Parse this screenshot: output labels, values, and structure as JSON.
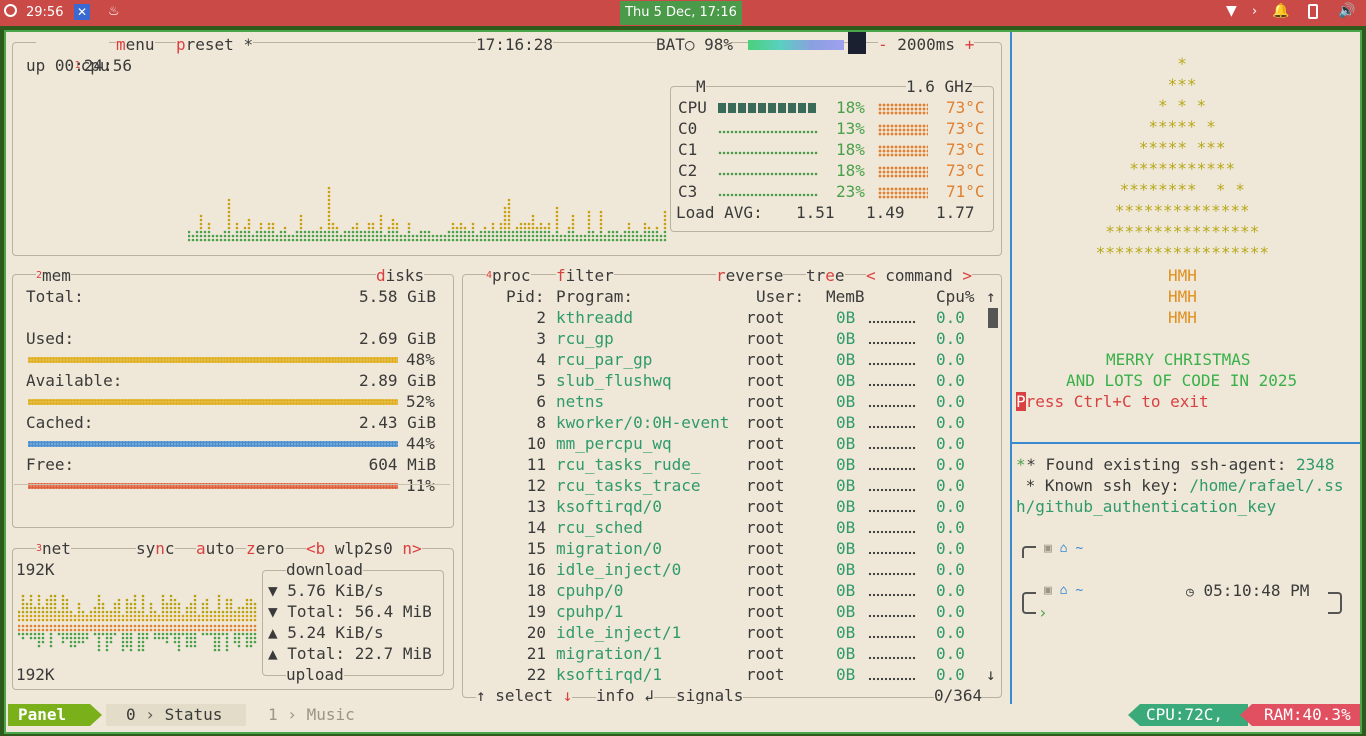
{
  "topbar": {
    "time": "29:56",
    "clock": "Thu  5 Dec, 17:16"
  },
  "cpu_box": {
    "title_num": "1",
    "title": "cpu",
    "menu": "menu",
    "preset": "preset *",
    "time": "17:16:28",
    "bat_label": "BAT○ 98%",
    "interval": "2000ms",
    "uptime": "up 00:24:56",
    "freq_label": "M",
    "freq": "1.6 GHz",
    "cores": [
      {
        "name": "CPU",
        "pct": "18%",
        "temp": "73°C"
      },
      {
        "name": "C0",
        "pct": "13%",
        "temp": "73°C"
      },
      {
        "name": "C1",
        "pct": "18%",
        "temp": "73°C"
      },
      {
        "name": "C2",
        "pct": "18%",
        "temp": "73°C"
      },
      {
        "name": "C3",
        "pct": "23%",
        "temp": "71°C"
      }
    ],
    "load_label": "Load AVG:",
    "load": [
      "1.51",
      "1.49",
      "1.77"
    ]
  },
  "mem_box": {
    "title_num": "2",
    "title": "mem",
    "disks": "disks",
    "rows": [
      {
        "label": "Total:",
        "value": "5.58 GiB",
        "pct": ""
      },
      {
        "label": "Used:",
        "value": "2.69 GiB",
        "pct": "48%"
      },
      {
        "label": "Available:",
        "value": "2.89 GiB",
        "pct": "52%"
      },
      {
        "label": "Cached:",
        "value": "2.43 GiB",
        "pct": "44%"
      },
      {
        "label": "Free:",
        "value": "604 MiB",
        "pct": "11%"
      }
    ]
  },
  "net_box": {
    "title_num": "3",
    "title": "net",
    "sync": "sync",
    "auto": "auto",
    "zero": "zero",
    "iface": "<b wlp2s0 n>",
    "top_scale": "192K",
    "bot_scale": "192K",
    "download": "download",
    "dl_rate": "▼ 5.76 KiB/s",
    "dl_total": "▼ Total: 56.4 MiB",
    "ul_rate": "▲ 5.24 KiB/s",
    "ul_total": "▲ Total: 22.7 MiB",
    "upload": "upload"
  },
  "proc_box": {
    "title_num": "4",
    "title": "proc",
    "filter": "filter",
    "reverse": "reverse",
    "tree": "tree",
    "sort": "< command >",
    "headers": {
      "pid": "Pid:",
      "program": "Program:",
      "user": "User:",
      "mem": "MemB",
      "cpu": "Cpu%"
    },
    "rows": [
      {
        "pid": "2",
        "program": "kthreadd",
        "user": "root",
        "mem": "0B",
        "cpu": "0.0"
      },
      {
        "pid": "3",
        "program": "rcu_gp",
        "user": "root",
        "mem": "0B",
        "cpu": "0.0"
      },
      {
        "pid": "4",
        "program": "rcu_par_gp",
        "user": "root",
        "mem": "0B",
        "cpu": "0.0"
      },
      {
        "pid": "5",
        "program": "slub_flushwq",
        "user": "root",
        "mem": "0B",
        "cpu": "0.0"
      },
      {
        "pid": "6",
        "program": "netns",
        "user": "root",
        "mem": "0B",
        "cpu": "0.0"
      },
      {
        "pid": "8",
        "program": "kworker/0:0H-event",
        "user": "root",
        "mem": "0B",
        "cpu": "0.0"
      },
      {
        "pid": "10",
        "program": "mm_percpu_wq",
        "user": "root",
        "mem": "0B",
        "cpu": "0.0"
      },
      {
        "pid": "11",
        "program": "rcu_tasks_rude_",
        "user": "root",
        "mem": "0B",
        "cpu": "0.0"
      },
      {
        "pid": "12",
        "program": "rcu_tasks_trace",
        "user": "root",
        "mem": "0B",
        "cpu": "0.0"
      },
      {
        "pid": "13",
        "program": "ksoftirqd/0",
        "user": "root",
        "mem": "0B",
        "cpu": "0.0"
      },
      {
        "pid": "14",
        "program": "rcu_sched",
        "user": "root",
        "mem": "0B",
        "cpu": "0.0"
      },
      {
        "pid": "15",
        "program": "migration/0",
        "user": "root",
        "mem": "0B",
        "cpu": "0.0"
      },
      {
        "pid": "16",
        "program": "idle_inject/0",
        "user": "root",
        "mem": "0B",
        "cpu": "0.0"
      },
      {
        "pid": "18",
        "program": "cpuhp/0",
        "user": "root",
        "mem": "0B",
        "cpu": "0.0"
      },
      {
        "pid": "19",
        "program": "cpuhp/1",
        "user": "root",
        "mem": "0B",
        "cpu": "0.0"
      },
      {
        "pid": "20",
        "program": "idle_inject/1",
        "user": "root",
        "mem": "0B",
        "cpu": "0.0"
      },
      {
        "pid": "21",
        "program": "migration/1",
        "user": "root",
        "mem": "0B",
        "cpu": "0.0"
      },
      {
        "pid": "22",
        "program": "ksoftirqd/1",
        "user": "root",
        "mem": "0B",
        "cpu": "0.0"
      }
    ],
    "footer_select": "↑ select ↓",
    "footer_info": "info ↲",
    "footer_signals": "signals",
    "count": "0/364"
  },
  "xmas": {
    "tree": [
      "*",
      "***",
      "* * *",
      "***** *",
      "***** ***",
      "***********",
      "********  * *",
      "**************",
      "****************",
      "******************"
    ],
    "trunk": [
      "HMH",
      "HMH",
      "HMH"
    ],
    "line1": "MERRY CHRISTMAS",
    "line2": "AND LOTS OF CODE IN 2025",
    "exit_p": "P",
    "exit_rest": "ress Ctrl+C to exit"
  },
  "shell": {
    "line1_a": " * Found existing ssh-agent: ",
    "line1_b": "2348",
    "line2_a": " * Known ssh key: ",
    "line2_b": "/home/rafael/.ss",
    "line3": "h/github_authentication_key",
    "prompt_path": "~",
    "prompt_time": "05:10:48 PM",
    "prompt_char": "›"
  },
  "statusbar": {
    "panel": "Panel",
    "win0_num": "0",
    "win0_name": "Status",
    "win1_num": "1",
    "win1_name": "Music",
    "cpu": "CPU:72C,",
    "ram": "RAM:40.3%"
  },
  "colors": {
    "topbar": "#c94a47",
    "clock": "#4a9a4a",
    "terminal_bg": "#efe8d8",
    "accent_red": "#d94040",
    "accent_green": "#2f9a6a"
  }
}
